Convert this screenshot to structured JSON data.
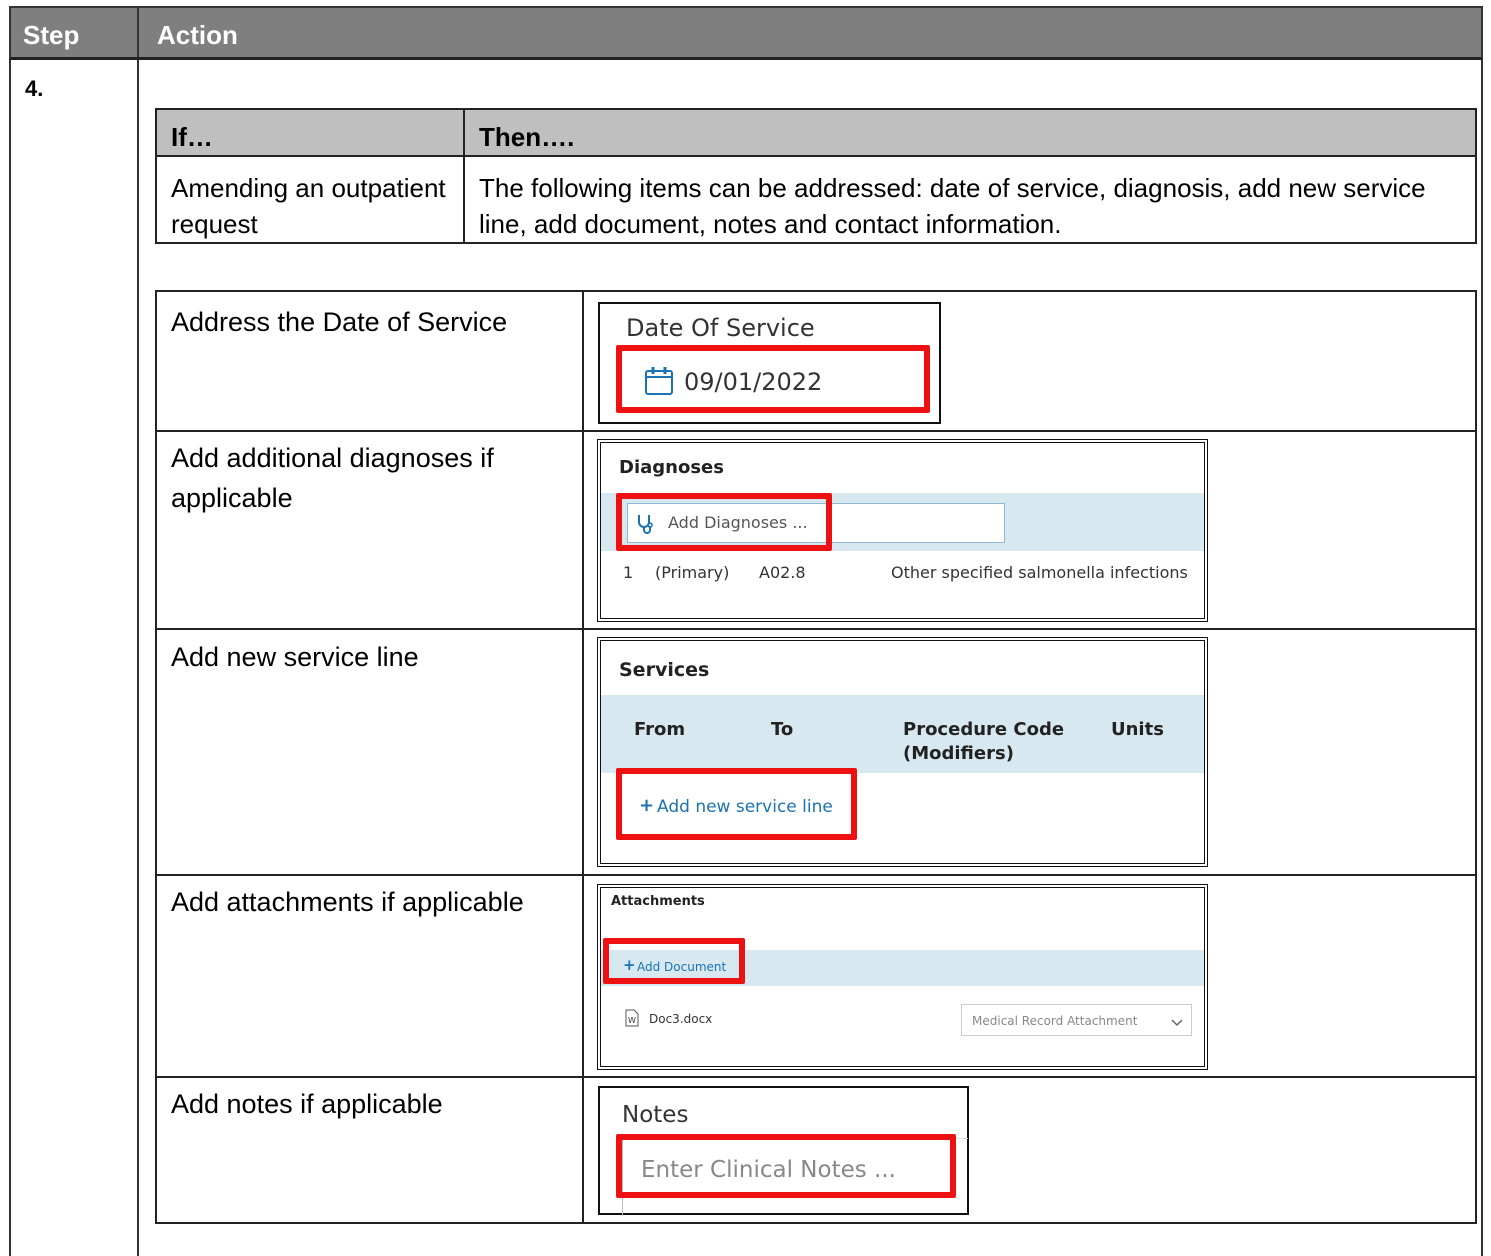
{
  "outer": {
    "header_step": "Step",
    "header_action": "Action",
    "step_number": "4."
  },
  "ifthen": {
    "header_if": "If…",
    "header_then": "Then….",
    "if_text": "Amending an outpatient request",
    "then_text": "The following items can be addressed: date of service, diagnosis, add new service line, add document, notes and contact information."
  },
  "rows": [
    {
      "label": "Address the Date of Service",
      "snippet": {
        "title": "Date Of Service",
        "value": "09/01/2022",
        "icon": "calendar-icon"
      }
    },
    {
      "label": "Add additional diagnoses if applicable",
      "snippet": {
        "title": "Diagnoses",
        "button": "Add Diagnoses ...",
        "icon": "stethoscope-icon",
        "entry_index": "1",
        "entry_type": "(Primary)",
        "entry_code": "A02.8",
        "entry_desc": "Other specified salmonella infections"
      }
    },
    {
      "label": "Add new service line",
      "snippet": {
        "title": "Services",
        "columns": [
          "From",
          "To",
          "Procedure Code (Modifiers)",
          "Units"
        ],
        "column_code_line1": "Procedure Code",
        "column_code_line2": "(Modifiers)",
        "link": "Add new service line"
      }
    },
    {
      "label": "Add attachments if applicable",
      "snippet": {
        "title": "Attachments",
        "link": "Add Document",
        "file_name": "Doc3.docx",
        "file_icon": "word-document-icon",
        "type_select": "Medical Record Attachment"
      }
    },
    {
      "label": "Add notes if applicable",
      "snippet": {
        "title": "Notes",
        "placeholder": "Enter Clinical Notes ..."
      }
    }
  ],
  "colors": {
    "header_bg": "#7f7f7f",
    "subheader_bg": "#bfbfbf",
    "highlight": "#ee1111",
    "band": "#d7e8f0",
    "link": "#1b73b3"
  }
}
